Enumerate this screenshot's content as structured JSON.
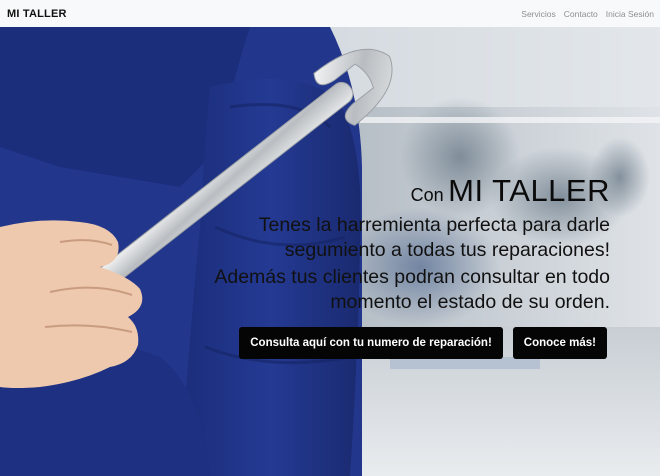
{
  "navbar": {
    "brand": "MI TALLER",
    "links": [
      {
        "label": "Servicios"
      },
      {
        "label": "Contacto"
      },
      {
        "label": "Inicia Sesión"
      }
    ]
  },
  "hero": {
    "headline_small": "Con",
    "headline_big": "MI TALLER",
    "tagline_1": "Tenes la harremienta perfecta para darle segumiento a todas tus reparaciones!",
    "tagline_2": "Además tus clientes podran consultar en todo momento el estado de su orden.",
    "buttons": [
      {
        "label": "Consulta aquí con tu numero de reparación!"
      },
      {
        "label": "Conoce más!"
      }
    ]
  },
  "colors": {
    "navbar_bg": "#f8f9fa",
    "button_bg": "#050505",
    "uniform_blue": "#20348a"
  }
}
